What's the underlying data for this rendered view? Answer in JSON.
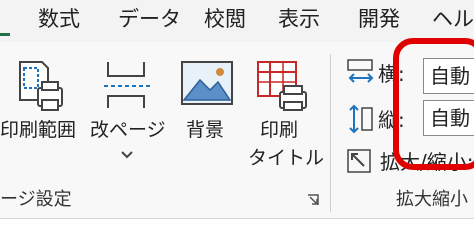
{
  "tabs": [
    {
      "label": "数式"
    },
    {
      "label": "データ"
    },
    {
      "label": "校閲"
    },
    {
      "label": "表示"
    },
    {
      "label": "開発"
    },
    {
      "label": "ヘル"
    }
  ],
  "ribbon": {
    "print_area": {
      "label": "印刷範囲"
    },
    "breaks": {
      "label": "改ページ"
    },
    "background": {
      "label": "背景"
    },
    "print_titles": {
      "label_line1": "印刷",
      "label_line2": "タイトル"
    },
    "page_setup_group_label": "ージ設定",
    "scale": {
      "width_label": "横:",
      "width_value": "自動",
      "height_label": "縦:",
      "height_value": "自動",
      "zoom_label": "拡大/縮小:",
      "group_label": "拡大縮小"
    }
  },
  "colors": {
    "accent_green": "#1e7145",
    "highlight_red": "#e00000"
  }
}
